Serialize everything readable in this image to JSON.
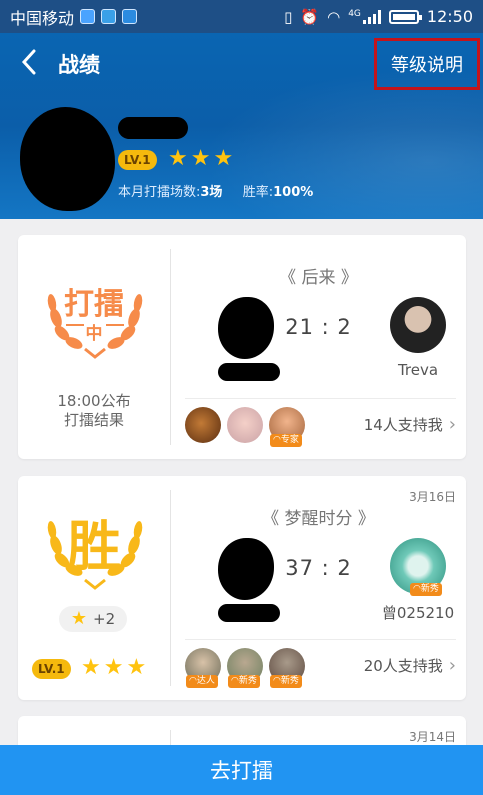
{
  "status_bar": {
    "carrier": "中国移动",
    "network": "4G",
    "time": "12:50"
  },
  "header": {
    "title": "战绩",
    "level_info": "等级说明",
    "user": {
      "level": "LV.1",
      "stars": 3,
      "stats_label": "本月打擂场数:",
      "stats_value": "3场",
      "win_label": "胜率:",
      "win_value": "100%"
    }
  },
  "battles": [
    {
      "status": "打擂",
      "status_sub": "中",
      "publish_text_1": "18:00公布",
      "publish_text_2": "打擂结果",
      "song": "《 后来 》",
      "score": "21 : 2",
      "opponent": "Treva",
      "supporters": [
        {
          "tag": ""
        },
        {
          "tag": ""
        },
        {
          "tag": "专家"
        }
      ],
      "support_text": "14人支持我"
    },
    {
      "date": "3月16日",
      "status": "胜",
      "bonus": "+2",
      "level": "LV.1",
      "stars": 3,
      "song": "《 梦醒时分 》",
      "score": "37 : 2",
      "opponent": "曾025210",
      "opponent_tag": "新秀",
      "supporters": [
        {
          "tag": "达人"
        },
        {
          "tag": "新秀"
        },
        {
          "tag": "新秀"
        }
      ],
      "support_text": "20人支持我"
    },
    {
      "date": "3月14日"
    }
  ],
  "action_button": "去打擂",
  "colors": {
    "header_blue": "#0b5ea9",
    "accent_orange": "#f68b4a",
    "win_gold": "#f8b819",
    "button_blue": "#2194f2",
    "highlight_red": "#c4141b"
  }
}
